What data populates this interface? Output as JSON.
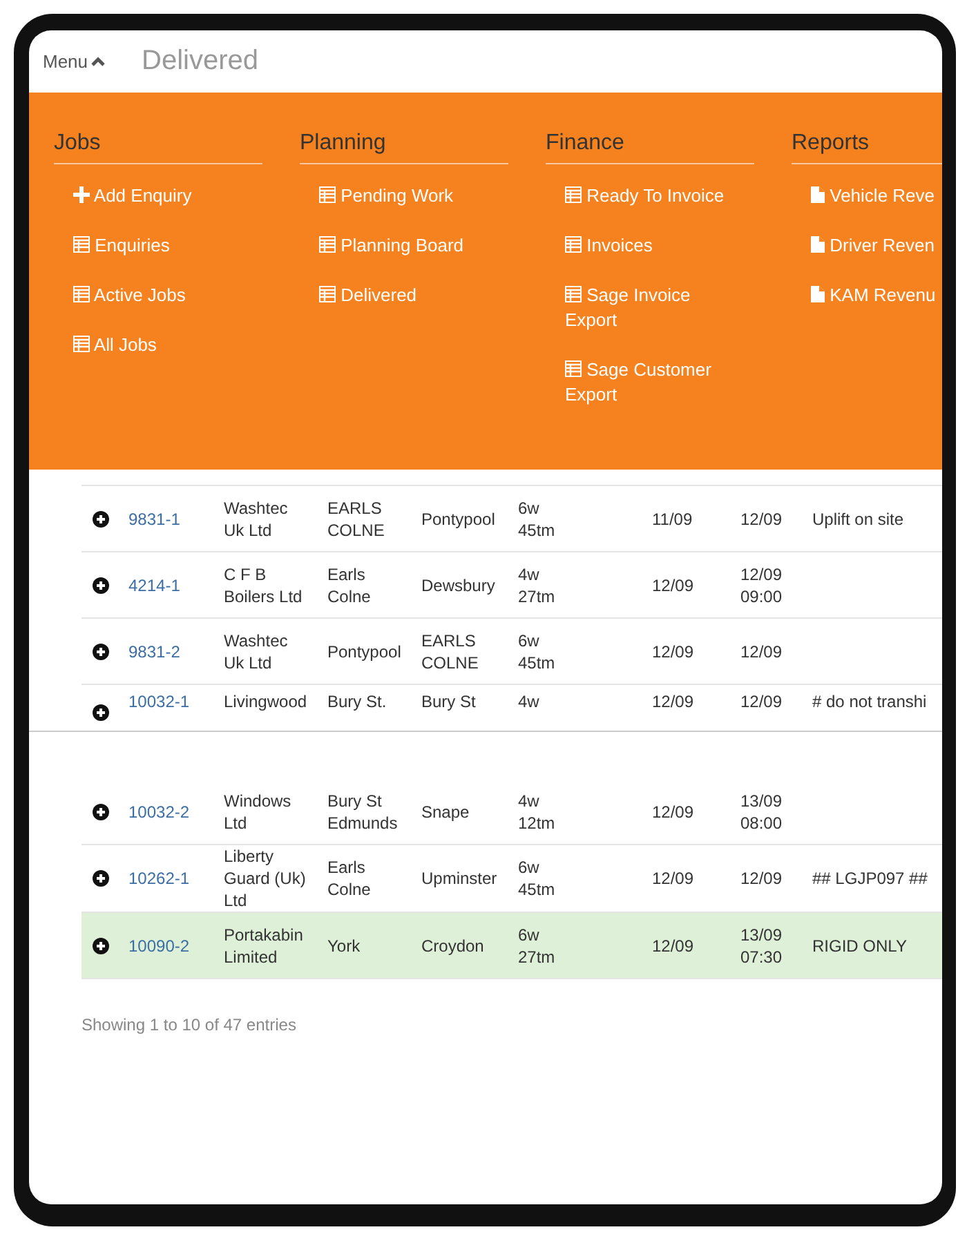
{
  "header": {
    "menu_label": "Menu",
    "menu_expanded": true,
    "title": "Delivered"
  },
  "menu": {
    "sections": [
      {
        "title": "Jobs",
        "items": [
          {
            "label": "Add Enquiry",
            "kind": "plus"
          },
          {
            "label": "Enquiries",
            "kind": "table"
          },
          {
            "label": "Active Jobs",
            "kind": "table"
          },
          {
            "label": "All Jobs",
            "kind": "table"
          }
        ]
      },
      {
        "title": "Planning",
        "items": [
          {
            "label": "Pending Work",
            "kind": "table"
          },
          {
            "label": "Planning Board",
            "kind": "table"
          },
          {
            "label": "Delivered",
            "kind": "table"
          }
        ]
      },
      {
        "title": "Finance",
        "items": [
          {
            "label": "Ready To Invoice",
            "kind": "table"
          },
          {
            "label": "Invoices",
            "kind": "table"
          },
          {
            "label": "Sage Invoice Export",
            "kind": "table"
          },
          {
            "label": "Sage Customer Export",
            "kind": "table"
          }
        ]
      },
      {
        "title": "Reports",
        "items": [
          {
            "label": "Vehicle Reve",
            "kind": "file"
          },
          {
            "label": "Driver Reven",
            "kind": "file"
          },
          {
            "label": "KAM Revenu",
            "kind": "file"
          }
        ]
      }
    ]
  },
  "table": {
    "rows": [
      {
        "kind": "full",
        "selected": false,
        "job": "9831-1",
        "customer": "Washtec\nUk Ltd",
        "from": "EARLS\nCOLNE",
        "to": "Pontypool",
        "size": "6w\n45tm",
        "date_1": "11/09",
        "date_2": "12/09",
        "notes": "Uplift on site"
      },
      {
        "kind": "full",
        "selected": false,
        "job": "4214-1",
        "customer": "C F B\nBoilers Ltd",
        "from": "Earls\nColne",
        "to": "Dewsbury",
        "size": "4w\n27tm",
        "date_1": "12/09",
        "date_2": "12/09\n09:00",
        "notes": ""
      },
      {
        "kind": "full",
        "selected": false,
        "job": "9831-2",
        "customer": "Washtec\nUk Ltd",
        "from": "Pontypool",
        "to": "EARLS\nCOLNE",
        "size": "6w\n45tm",
        "date_1": "12/09",
        "date_2": "12/09",
        "notes": ""
      },
      {
        "kind": "cut",
        "selected": false,
        "job": "10032-1",
        "customer": "Livingwood",
        "from": "Bury St.",
        "to": "Bury St",
        "size": "4w",
        "date_1": "12/09",
        "date_2": "12/09",
        "notes": "# do not transhi"
      },
      {
        "kind": "full",
        "selected": false,
        "job": "10032-2",
        "customer": "Windows\nLtd",
        "from": "Bury St\nEdmunds",
        "to": "Snape",
        "size": "4w\n12tm",
        "date_1": "12/09",
        "date_2": "13/09\n08:00",
        "notes": ""
      },
      {
        "kind": "full",
        "selected": false,
        "job": "10262-1",
        "customer": "Liberty\nGuard (Uk)\nLtd",
        "from": "Earls\nColne",
        "to": "Upminster",
        "size": "6w\n45tm",
        "date_1": "12/09",
        "date_2": "12/09",
        "notes": "## LGJP097 ##"
      },
      {
        "kind": "full",
        "selected": true,
        "job": "10090-2",
        "customer": "Portakabin\nLimited",
        "from": "York",
        "to": "Croydon",
        "size": "6w\n27tm",
        "date_1": "12/09",
        "date_2": "13/09\n07:30",
        "notes": "RIGID ONLY"
      }
    ]
  },
  "footer": {
    "info": "Showing 1 to 10 of 47 entries"
  }
}
